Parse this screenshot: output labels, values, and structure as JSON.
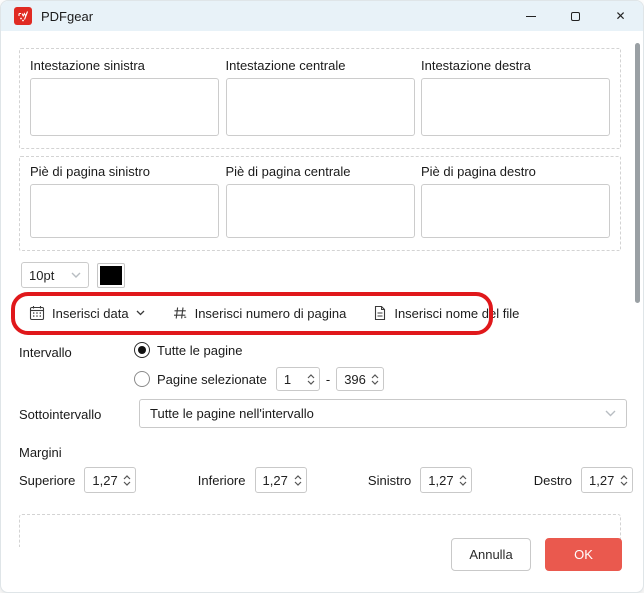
{
  "window": {
    "title": "PDFgear"
  },
  "titlebar": {
    "close_glyph": "✕"
  },
  "icons": {
    "titlebar": [
      "minimize-icon",
      "maximize-icon",
      "close-icon"
    ],
    "toolbar": [
      "calendar-icon",
      "page-number-icon",
      "file-name-icon"
    ],
    "dropdowns": "chevron-down-icon",
    "spinners": [
      "chevron-up-icon",
      "chevron-down-icon"
    ]
  },
  "headers": {
    "fields": [
      {
        "label": "Intestazione sinistra",
        "value": ""
      },
      {
        "label": "Intestazione centrale",
        "value": ""
      },
      {
        "label": "Intestazione destra",
        "value": ""
      }
    ]
  },
  "footers": {
    "fields": [
      {
        "label": "Piè di pagina sinistro",
        "value": ""
      },
      {
        "label": "Piè di pagina centrale",
        "value": ""
      },
      {
        "label": "Piè di pagina destro",
        "value": ""
      }
    ]
  },
  "font": {
    "size": "10pt",
    "color": "#000000"
  },
  "insert_toolbar": {
    "highlight_color": "#e0181b",
    "buttons": [
      {
        "label": "Inserisci data",
        "icon": "calendar-icon",
        "has_dropdown": true
      },
      {
        "label": "Inserisci numero di pagina",
        "icon": "page-number-icon",
        "has_dropdown": false
      },
      {
        "label": "Inserisci nome del file",
        "icon": "file-name-icon",
        "has_dropdown": false
      }
    ]
  },
  "interval": {
    "label": "Intervallo",
    "option_all": {
      "label": "Tutte le pagine",
      "selected": true
    },
    "option_pages": {
      "label": "Pagine selezionate",
      "selected": false,
      "from": "1",
      "separator": "-",
      "to": "396"
    }
  },
  "subinterval": {
    "label": "Sottointervallo",
    "value": "Tutte le pagine nell'intervallo"
  },
  "margins": {
    "title": "Margini",
    "fields": [
      {
        "label": "Superiore",
        "value": "1,27"
      },
      {
        "label": "Inferiore",
        "value": "1,27"
      },
      {
        "label": "Sinistro",
        "value": "1,27"
      },
      {
        "label": "Destro",
        "value": "1,27"
      }
    ]
  },
  "actions": {
    "cancel": "Annulla",
    "ok": "OK",
    "ok_color": "#ea594e"
  }
}
